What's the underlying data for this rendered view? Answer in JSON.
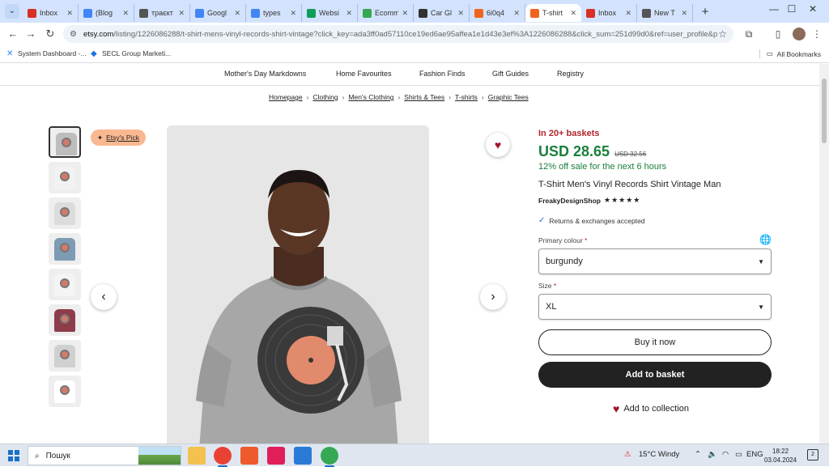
{
  "browser": {
    "tabs": [
      {
        "label": "Inbox",
        "color": "#d93025"
      },
      {
        "label": "(Blog",
        "color": "#4285f4"
      },
      {
        "label": "траєкт",
        "color": "#555555"
      },
      {
        "label": "Googl",
        "color": "#4285f4"
      },
      {
        "label": "types",
        "color": "#4285f4"
      },
      {
        "label": "Websi",
        "color": "#0f9d58"
      },
      {
        "label": "Ecomm",
        "color": "#34a853"
      },
      {
        "label": "Car Gl",
        "color": "#333333"
      },
      {
        "label": "6i0q4",
        "color": "#f1641e"
      },
      {
        "label": "T-shirt",
        "color": "#f1641e"
      },
      {
        "label": "Inbox",
        "color": "#d93025"
      },
      {
        "label": "New T",
        "color": "#555555"
      }
    ],
    "active_tab_index": 9,
    "url_domain": "etsy.com",
    "url_rest": "/listing/1226086288/t-shirt-mens-vinyl-records-shirt-vintage?click_key=ada3ff0ad57110ce19ed6ae95affea1e1d43e3ef%3A1226086288&click_sum=251d99d0&ref=user_profile&p...",
    "bookmarks": [
      {
        "label": "System Dashboard -..."
      },
      {
        "label": "SECL Group Marketi..."
      }
    ],
    "all_bookmarks": "All Bookmarks"
  },
  "etsy": {
    "categories": [
      "Mother's Day Markdowns",
      "Home Favourites",
      "Fashion Finds",
      "Gift Guides",
      "Registry"
    ],
    "breadcrumbs": [
      "Homepage",
      "Clothing",
      "Men's Clothing",
      "Shirts & Tees",
      "T-shirts",
      "Graphic Tees"
    ],
    "etsy_pick": "Etsy's Pick",
    "baskets": "In 20+ baskets",
    "price": "USD 28.65",
    "old_price": "USD 32.56",
    "sale_text": "12% off sale for the next 6 hours",
    "title": "T-Shirt Men's Vinyl Records Shirt Vintage Man",
    "shop": "FreakyDesignShop",
    "rating_stars": "★★★★★",
    "returns": "Returns & exchanges accepted",
    "primary_colour_label": "Primary colour",
    "primary_colour_value": "burgundy",
    "size_label": "Size",
    "size_value": "XL",
    "buy_now": "Buy it now",
    "add_to_basket": "Add to basket",
    "add_to_collection": "Add to collection",
    "thumb_colors": [
      "#bdbdbd",
      "#f2f2f2",
      "#dcdcdc",
      "#7d9cb3",
      "#f4f4f4",
      "#8e3b4a",
      "#d0d0d0",
      "#ffffff"
    ]
  },
  "taskbar": {
    "search": "Пошук",
    "weather": "15°C  Windy",
    "lang": "ENG",
    "time": "18:22",
    "date": "03.04.2024",
    "notifications": "2"
  }
}
